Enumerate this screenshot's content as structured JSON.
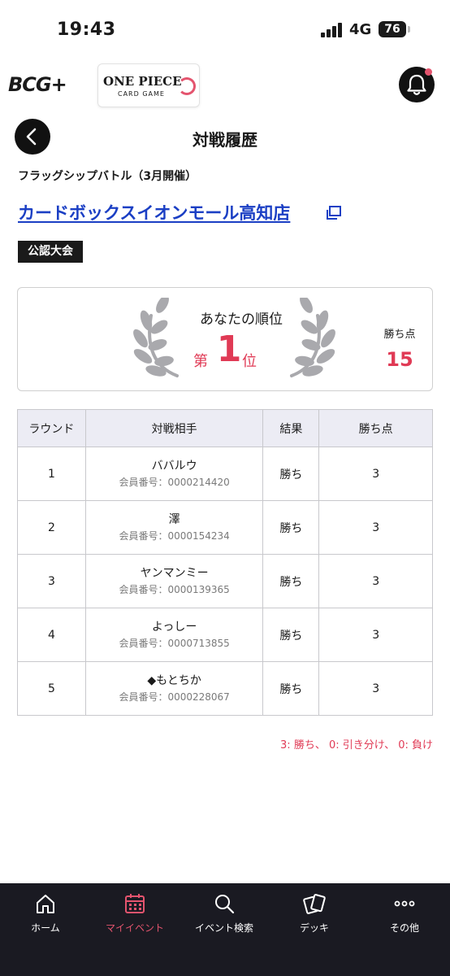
{
  "status_bar": {
    "time": "19:43",
    "network": "4G",
    "battery": "76"
  },
  "header": {
    "brand": "BCG+",
    "partner_logo": {
      "title": "ONE PIECE",
      "subtitle": "CARD GAME"
    },
    "bell_icon": "bell-icon"
  },
  "page": {
    "title": "対戦履歴",
    "event_name": "フラッグシップバトル（3月開催）",
    "store_name": "カードボックスイオンモール高知店",
    "badge": "公認大会"
  },
  "rank": {
    "label": "あなたの順位",
    "prefix": "第",
    "number": "1",
    "suffix": "位",
    "points_label": "勝ち点",
    "points_value": "15"
  },
  "table": {
    "headers": [
      "ラウンド",
      "対戦相手",
      "結果",
      "勝ち点"
    ],
    "rows": [
      {
        "round": "1",
        "opponent": "ババルウ",
        "member_id": "会員番号：0000214420",
        "result": "勝ち",
        "points": "3"
      },
      {
        "round": "2",
        "opponent": "澤",
        "member_id": "会員番号：0000154234",
        "result": "勝ち",
        "points": "3"
      },
      {
        "round": "3",
        "opponent": "ヤンマンミー",
        "member_id": "会員番号：0000139365",
        "result": "勝ち",
        "points": "3"
      },
      {
        "round": "4",
        "opponent": "よっしー",
        "member_id": "会員番号：0000713855",
        "result": "勝ち",
        "points": "3"
      },
      {
        "round": "5",
        "opponent": "◆もとちか",
        "member_id": "会員番号：0000228067",
        "result": "勝ち",
        "points": "3"
      }
    ]
  },
  "legend": "3: 勝ち、 0: 引き分け、 0: 負け",
  "colors": {
    "accent": "#e03a55",
    "link": "#1b3fc4",
    "nav_bg": "#1a1a22"
  },
  "bottom_nav": [
    {
      "label": "ホーム",
      "icon": "home-icon",
      "active": false
    },
    {
      "label": "マイイベント",
      "icon": "calendar-icon",
      "active": true
    },
    {
      "label": "イベント検索",
      "icon": "search-icon",
      "active": false
    },
    {
      "label": "デッキ",
      "icon": "cards-icon",
      "active": false
    },
    {
      "label": "その他",
      "icon": "more-icon",
      "active": false
    }
  ]
}
